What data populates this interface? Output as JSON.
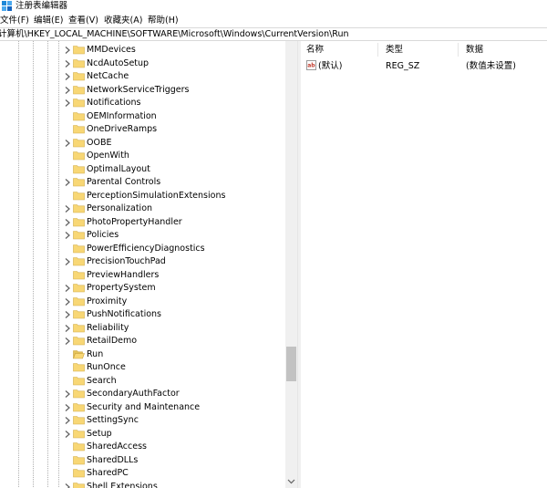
{
  "window": {
    "title": "注册表编辑器",
    "app_icon": "regedit-icon"
  },
  "menu": {
    "items": [
      {
        "label": "文件(F)"
      },
      {
        "label": "编辑(E)"
      },
      {
        "label": "查看(V)"
      },
      {
        "label": "收藏夹(A)"
      },
      {
        "label": "帮助(H)"
      }
    ]
  },
  "address": {
    "path": "计算机\\HKEY_LOCAL_MACHINE\\SOFTWARE\\Microsoft\\Windows\\CurrentVersion\\Run"
  },
  "tree": {
    "folder_color": "#f8d775",
    "selected": "Run",
    "items": [
      {
        "label": "MMDevices",
        "expandable": true
      },
      {
        "label": "NcdAutoSetup",
        "expandable": true
      },
      {
        "label": "NetCache",
        "expandable": true
      },
      {
        "label": "NetworkServiceTriggers",
        "expandable": true
      },
      {
        "label": "Notifications",
        "expandable": true
      },
      {
        "label": "OEMInformation",
        "expandable": false
      },
      {
        "label": "OneDriveRamps",
        "expandable": false
      },
      {
        "label": "OOBE",
        "expandable": true
      },
      {
        "label": "OpenWith",
        "expandable": false
      },
      {
        "label": "OptimalLayout",
        "expandable": false
      },
      {
        "label": "Parental Controls",
        "expandable": true
      },
      {
        "label": "PerceptionSimulationExtensions",
        "expandable": false
      },
      {
        "label": "Personalization",
        "expandable": true
      },
      {
        "label": "PhotoPropertyHandler",
        "expandable": true
      },
      {
        "label": "Policies",
        "expandable": true
      },
      {
        "label": "PowerEfficiencyDiagnostics",
        "expandable": false
      },
      {
        "label": "PrecisionTouchPad",
        "expandable": true
      },
      {
        "label": "PreviewHandlers",
        "expandable": false
      },
      {
        "label": "PropertySystem",
        "expandable": true
      },
      {
        "label": "Proximity",
        "expandable": true
      },
      {
        "label": "PushNotifications",
        "expandable": true
      },
      {
        "label": "Reliability",
        "expandable": true
      },
      {
        "label": "RetailDemo",
        "expandable": true
      },
      {
        "label": "Run",
        "expandable": false
      },
      {
        "label": "RunOnce",
        "expandable": false
      },
      {
        "label": "Search",
        "expandable": false
      },
      {
        "label": "SecondaryAuthFactor",
        "expandable": true
      },
      {
        "label": "Security and Maintenance",
        "expandable": true
      },
      {
        "label": "SettingSync",
        "expandable": true
      },
      {
        "label": "Setup",
        "expandable": true
      },
      {
        "label": "SharedAccess",
        "expandable": false
      },
      {
        "label": "SharedDLLs",
        "expandable": false
      },
      {
        "label": "SharedPC",
        "expandable": false
      },
      {
        "label": "Shell Extensions",
        "expandable": true
      }
    ]
  },
  "list": {
    "headers": {
      "name": "名称",
      "type": "类型",
      "data": "数据"
    },
    "rows": [
      {
        "icon": "string-value-icon",
        "name": "(默认)",
        "type": "REG_SZ",
        "data": "(数值未设置)"
      }
    ]
  }
}
